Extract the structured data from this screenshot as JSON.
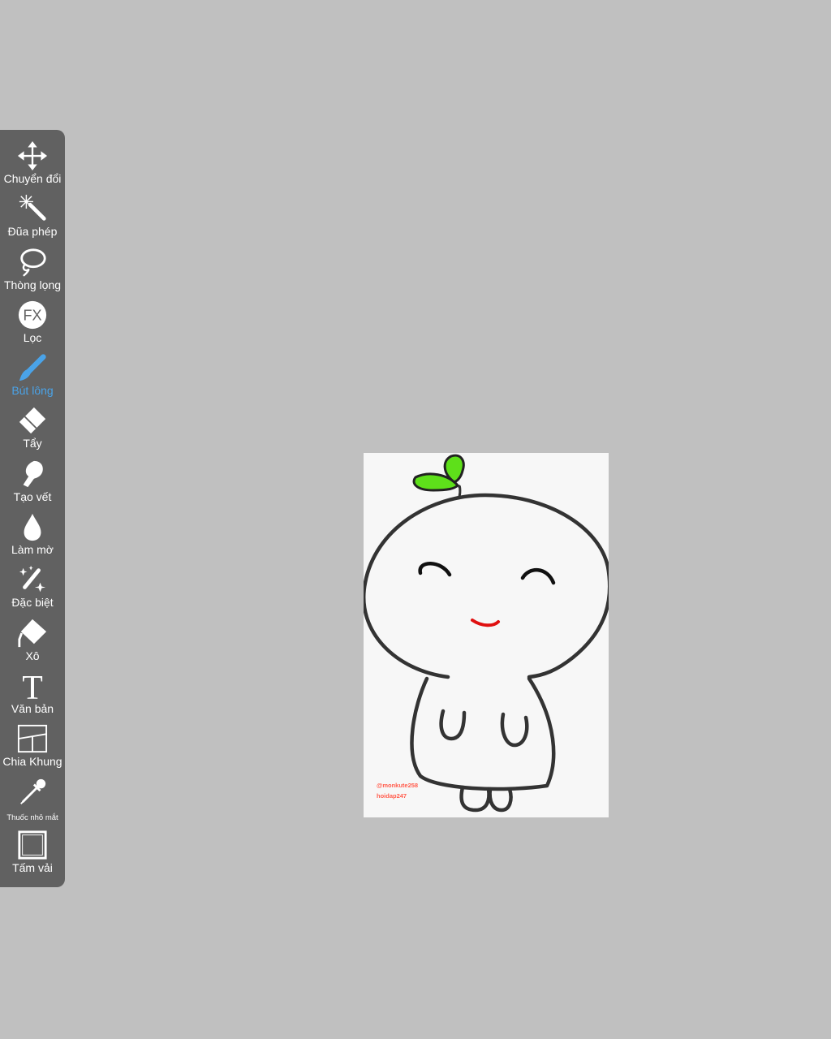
{
  "toolbar": {
    "tools": [
      {
        "label": "Chuyển đổi",
        "icon": "move-arrows-icon"
      },
      {
        "label": "Đũa phép",
        "icon": "magic-wand-icon"
      },
      {
        "label": "Thòng lọng",
        "icon": "lasso-icon"
      },
      {
        "label": "Lọc",
        "icon": "fx-filter-icon"
      },
      {
        "label": "Bút lông",
        "icon": "brush-icon",
        "active": true
      },
      {
        "label": "Tẩy",
        "icon": "eraser-icon"
      },
      {
        "label": "Tạo vết",
        "icon": "smudge-finger-icon"
      },
      {
        "label": "Làm mờ",
        "icon": "blur-drop-icon"
      },
      {
        "label": "Đặc biệt",
        "icon": "sparkle-pen-icon"
      },
      {
        "label": "Xô",
        "icon": "paint-bucket-icon"
      },
      {
        "label": "Văn bản",
        "icon": "text-t-icon"
      },
      {
        "label": "Chia Khung",
        "icon": "frame-divider-icon"
      },
      {
        "label": "Thuốc nhỏ mắt",
        "icon": "eyedropper-icon"
      },
      {
        "label": "Tấm vải",
        "icon": "canvas-icon"
      }
    ]
  },
  "canvas": {
    "signature_line1": "@monkute258",
    "signature_line2": "hoidap247"
  },
  "colors": {
    "background": "#c0c0c0",
    "toolbar": "#616161",
    "active_tool": "#4aa3e8",
    "sprout": "#5ee01a",
    "mouth": "#e01010",
    "outline": "#333333"
  }
}
